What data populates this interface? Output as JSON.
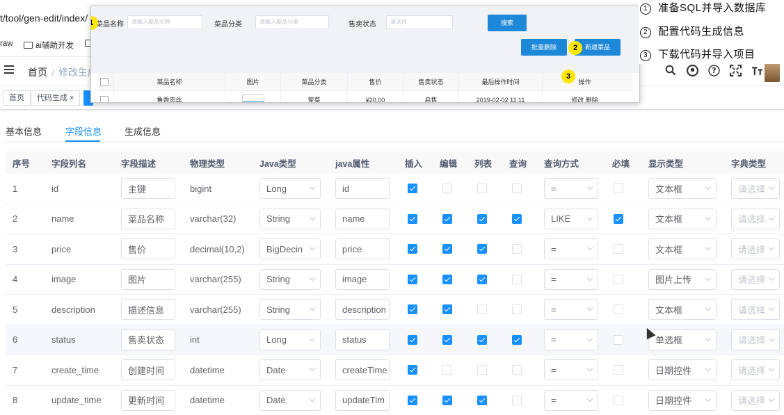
{
  "browser": {
    "url": "t/tool/gen-edit/index/",
    "bookmarks": [
      {
        "label": "raw",
        "folder": false
      },
      {
        "label": "ai辅助开发",
        "folder": true
      },
      {
        "label": "",
        "folder": true
      }
    ]
  },
  "header": {
    "breadcrumb_home": "首页",
    "breadcrumb_separator": "/",
    "breadcrumb_current": "修改生成",
    "tools": [
      "search-icon",
      "github-icon",
      "question-icon",
      "fullscreen-icon",
      "font-size-icon"
    ]
  },
  "tags": [
    {
      "label": "首页",
      "active": false
    },
    {
      "label": "代码生成 ×",
      "active": false
    },
    {
      "label": "",
      "active": true
    }
  ],
  "overlay": {
    "filters": [
      {
        "label": "菜品名称",
        "placeholder": "请输入菜品名称"
      },
      {
        "label": "菜品分类",
        "placeholder": "请输入菜品分类"
      },
      {
        "label": "售卖状态",
        "placeholder": "请选择"
      }
    ],
    "search_button": "搜索",
    "batch_delete_button": "批量删除",
    "new_button": "新建菜品",
    "columns": [
      "菜品名称",
      "图片",
      "菜品分类",
      "售价",
      "售卖状态",
      "最后操作时间",
      "操作"
    ],
    "row": {
      "name": "鲁香肉丝",
      "category": "荤菜",
      "price": "¥20.00",
      "status": "启售",
      "time": "2019-02-02 11:11",
      "actions": "修改 删除"
    },
    "markers": [
      "1",
      "2",
      "3"
    ]
  },
  "steps": [
    {
      "num": "1",
      "text": "准备SQL并导入数据库"
    },
    {
      "num": "2",
      "text": "配置代码生成信息"
    },
    {
      "num": "3",
      "text": "下载代码并导入项目"
    }
  ],
  "tabs": [
    {
      "label": "基本信息",
      "active": false
    },
    {
      "label": "字段信息",
      "active": true
    },
    {
      "label": "生成信息",
      "active": false
    }
  ],
  "table": {
    "headers": [
      "序号",
      "字段列名",
      "字段描述",
      "物理类型",
      "Java类型",
      "java属性",
      "插入",
      "编辑",
      "列表",
      "查询",
      "查询方式",
      "必填",
      "显示类型",
      "字典类型"
    ],
    "rows": [
      {
        "no": "1",
        "column": "id",
        "desc": "主键",
        "phys": "bigint",
        "java_type": "Long",
        "java_prop": "id",
        "insert": true,
        "edit": false,
        "list": false,
        "query": false,
        "query_type": "=",
        "required": false,
        "display": "文本框",
        "dict": "请选择"
      },
      {
        "no": "2",
        "column": "name",
        "desc": "菜品名称",
        "phys": "varchar(32)",
        "java_type": "String",
        "java_prop": "name",
        "insert": true,
        "edit": true,
        "list": true,
        "query": true,
        "query_type": "LIKE",
        "required": true,
        "display": "文本框",
        "dict": "请选择"
      },
      {
        "no": "3",
        "column": "price",
        "desc": "售价",
        "phys": "decimal(10,2)",
        "java_type": "BigDecin",
        "java_prop": "price",
        "insert": true,
        "edit": true,
        "list": true,
        "query": false,
        "query_type": "=",
        "required": false,
        "display": "文本框",
        "dict": "请选择"
      },
      {
        "no": "4",
        "column": "image",
        "desc": "图片",
        "phys": "varchar(255)",
        "java_type": "String",
        "java_prop": "image",
        "insert": true,
        "edit": true,
        "list": true,
        "query": false,
        "query_type": "=",
        "required": false,
        "display": "图片上传",
        "dict": "请选择"
      },
      {
        "no": "5",
        "column": "description",
        "desc": "描述信息",
        "phys": "varchar(255)",
        "java_type": "String",
        "java_prop": "description",
        "insert": true,
        "edit": true,
        "list": false,
        "query": false,
        "query_type": "=",
        "required": false,
        "display": "文本框",
        "dict": "请选择"
      },
      {
        "no": "6",
        "column": "status",
        "desc": "售卖状态",
        "phys": "int",
        "java_type": "Long",
        "java_prop": "status",
        "insert": true,
        "edit": true,
        "list": true,
        "query": true,
        "query_type": "=",
        "required": false,
        "display": "单选框",
        "dict": "请选择"
      },
      {
        "no": "7",
        "column": "create_time",
        "desc": "创建时间",
        "phys": "datetime",
        "java_type": "Date",
        "java_prop": "createTime",
        "insert": true,
        "edit": false,
        "list": false,
        "query": false,
        "query_type": "=",
        "required": false,
        "display": "日期控件",
        "dict": "请选择"
      },
      {
        "no": "8",
        "column": "update_time",
        "desc": "更新时间",
        "phys": "datetime",
        "java_type": "Date",
        "java_prop": "updateTim",
        "insert": true,
        "edit": true,
        "list": true,
        "query": false,
        "query_type": "=",
        "required": false,
        "display": "日期控件",
        "dict": "请选择"
      }
    ]
  },
  "colors": {
    "primary": "#1890ff",
    "marker": "#ffe600"
  }
}
